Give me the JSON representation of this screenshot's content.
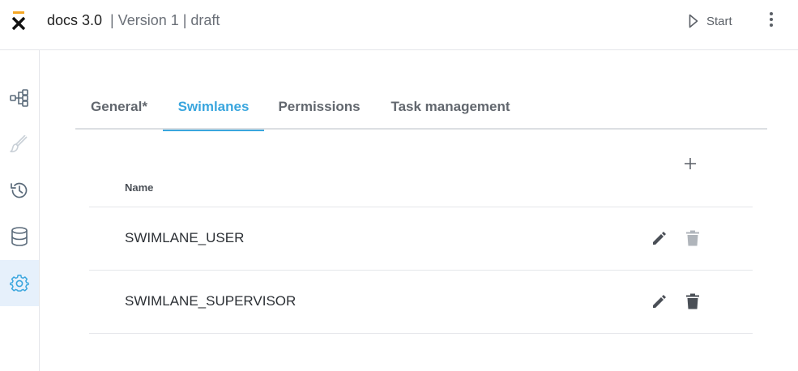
{
  "header": {
    "app_title": "docs 3.0",
    "version_info": "| Version 1 | draft",
    "start_label": "Start"
  },
  "sidebar": {
    "items": [
      {
        "name": "process-diagram-icon",
        "active": false
      },
      {
        "name": "brush-icon",
        "active": false,
        "disabled": true
      },
      {
        "name": "history-icon",
        "active": false
      },
      {
        "name": "database-icon",
        "active": false
      },
      {
        "name": "gear-icon",
        "active": true
      }
    ]
  },
  "tabs": [
    {
      "label": "General*",
      "active": false
    },
    {
      "label": "Swimlanes",
      "active": true
    },
    {
      "label": "Permissions",
      "active": false
    },
    {
      "label": "Task management",
      "active": false
    }
  ],
  "table": {
    "column_name": "Name",
    "rows": [
      {
        "name": "SWIMLANE_USER",
        "delete_enabled": false
      },
      {
        "name": "SWIMLANE_SUPERVISOR",
        "delete_enabled": true
      }
    ]
  },
  "colors": {
    "accent": "#3aa6de",
    "active_bg": "#e6f0fb",
    "logo_orange": "#f5a623"
  }
}
